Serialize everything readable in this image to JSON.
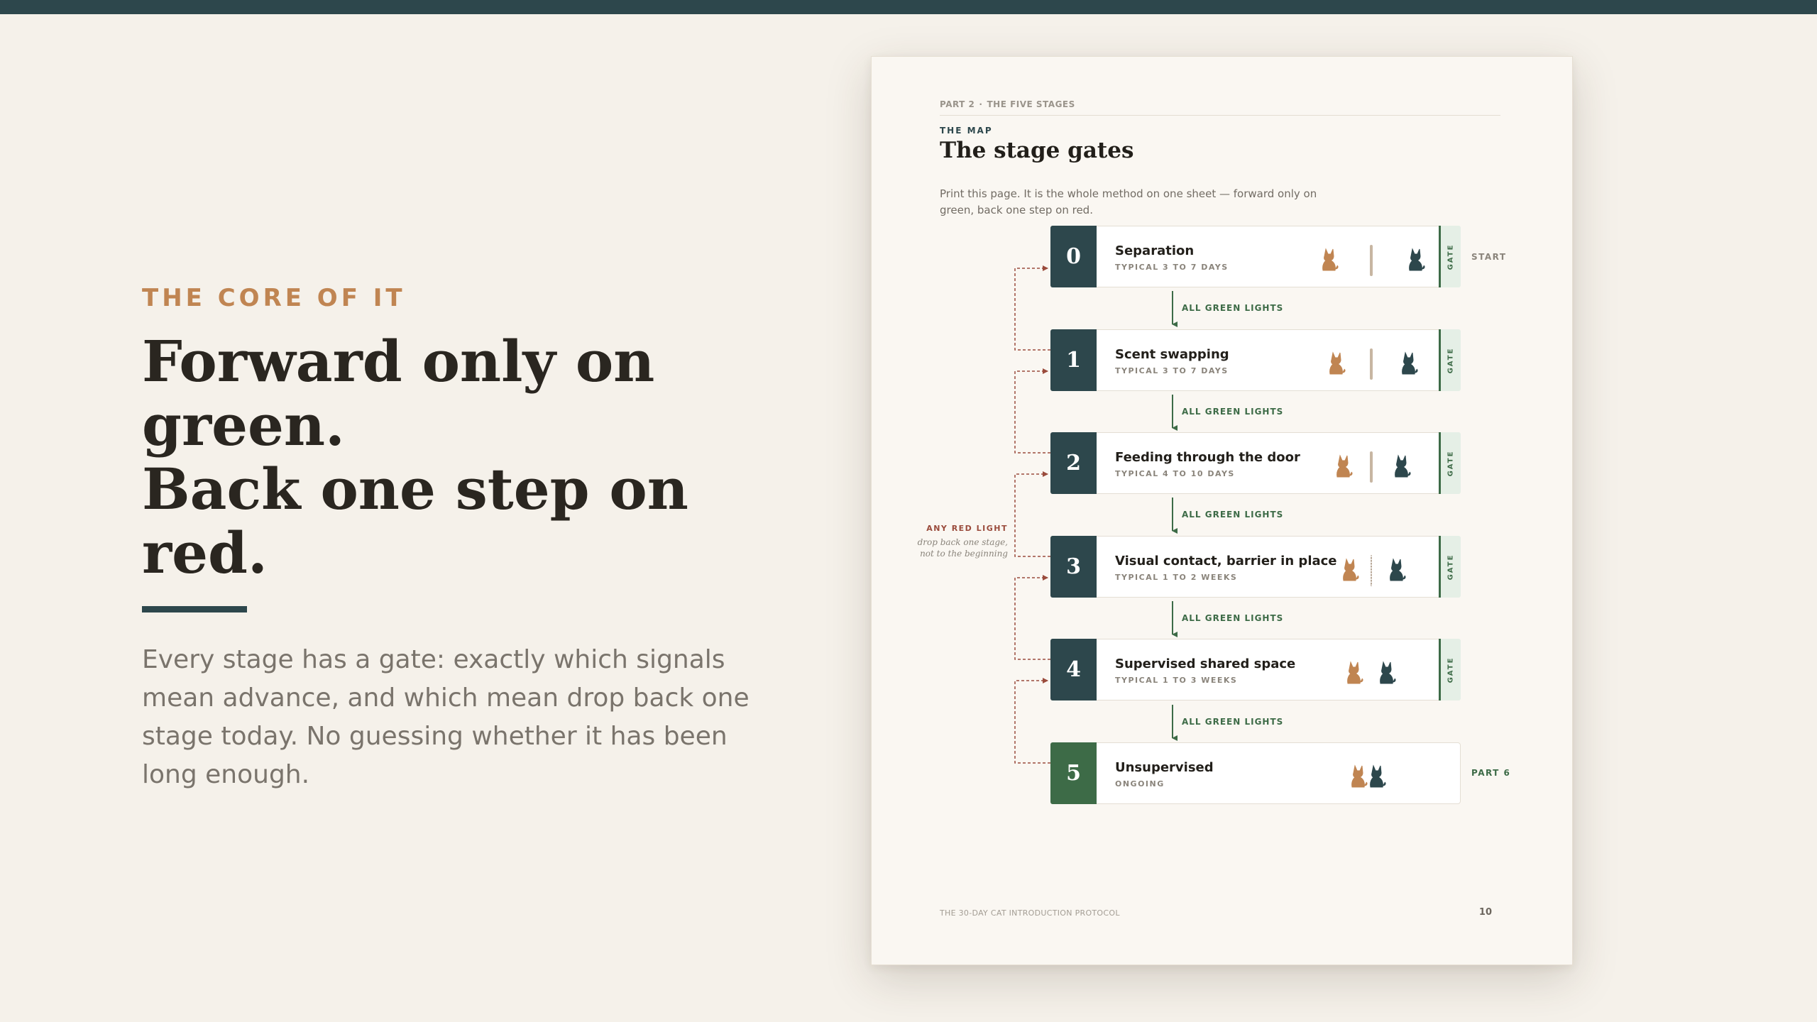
{
  "slide": {
    "eyebrow": "THE CORE OF IT",
    "headline_lines": [
      "Forward only on",
      "green.",
      "Back one step on",
      "red."
    ],
    "body": "Every stage has a gate: exactly which signals mean advance, and which mean drop back one stage today. No guessing whether it has been long enough."
  },
  "document": {
    "running_head": {
      "part": "PART 2",
      "separator": "·",
      "section": "THE FIVE STAGES"
    },
    "label": "THE MAP",
    "title": "The stage gates",
    "intro": "Print this page. It is the whole method on one sheet — forward only on green, back one step on red.",
    "stages": [
      {
        "number": "0",
        "name": "Separation",
        "duration": "TYPICAL 3 TO 7 DAYS",
        "gate": "GATE",
        "side_label": "START"
      },
      {
        "number": "1",
        "name": "Scent swapping",
        "duration": "TYPICAL 3 TO 7 DAYS",
        "gate": "GATE"
      },
      {
        "number": "2",
        "name": "Feeding through the door",
        "duration": "TYPICAL 4 TO 10 DAYS",
        "gate": "GATE"
      },
      {
        "number": "3",
        "name": "Visual contact, barrier in place",
        "duration": "TYPICAL 1 TO 2 WEEKS",
        "gate": "GATE"
      },
      {
        "number": "4",
        "name": "Supervised shared space",
        "duration": "TYPICAL 1 TO 3 WEEKS",
        "gate": "GATE"
      },
      {
        "number": "5",
        "name": "Unsupervised",
        "duration": "ONGOING",
        "side_label": "PART 6"
      }
    ],
    "advance_label": "ALL GREEN LIGHTS",
    "red_light": {
      "title": "ANY RED LIGHT",
      "note": "drop back one stage, not to the beginning"
    },
    "footer": "THE 30-DAY CAT INTRODUCTION PROTOCOL",
    "page_number": "10"
  },
  "colors": {
    "background": "#f5f1ea",
    "dark_teal": "#2d474c",
    "accent_orange": "#c08552",
    "gate_green": "#3d6b47",
    "red_arrow": "#9a4b3c",
    "cat_orange": "#c08552",
    "cat_dark": "#2d474c"
  },
  "icons": [
    "sitting-cat-icon",
    "vertical-barrier-icon",
    "arrow-down-icon",
    "arrow-right-icon"
  ]
}
